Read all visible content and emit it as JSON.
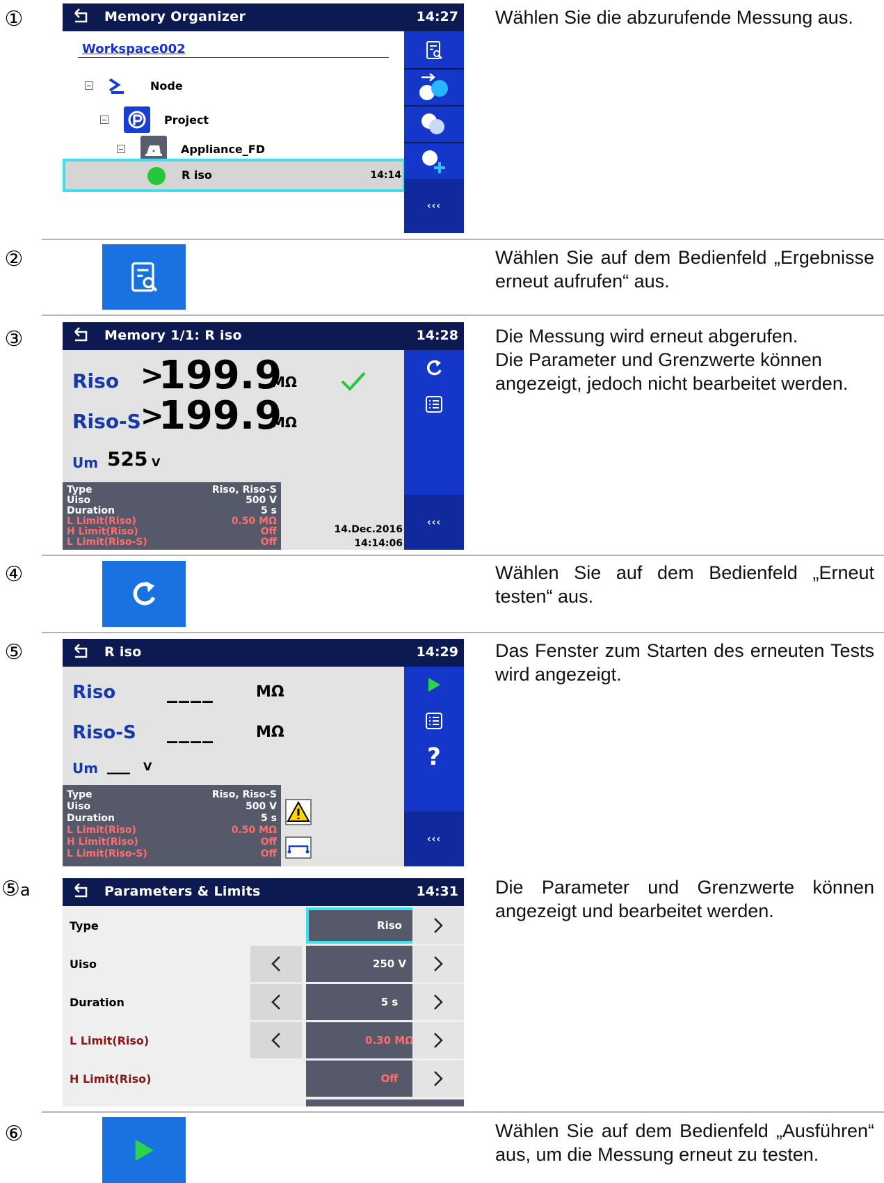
{
  "steps": [
    {
      "num": "①",
      "desc": [
        "Wählen Sie die abzurufende Messung aus."
      ]
    },
    {
      "num": "②",
      "desc": [
        "Wählen Sie auf dem Bedienfeld „Ergebnisse erneut aufrufen“ aus."
      ]
    },
    {
      "num": "③",
      "desc": [
        "Die Messung wird erneut abgerufen.",
        "Die Parameter und Grenzwerte können angezeigt, jedoch nicht bearbeitet werden."
      ]
    },
    {
      "num": "④",
      "desc": [
        "Wählen Sie auf dem Bedienfeld „Erneut testen“ aus."
      ]
    },
    {
      "num": "⑤",
      "desc": [
        "Das Fenster zum Starten des erneuten Tests wird angezeigt."
      ]
    },
    {
      "num": "⑤",
      "sub": "a",
      "desc": [
        "Die Parameter und Grenzwerte können angezeigt und bearbeitet werden."
      ]
    },
    {
      "num": "⑥",
      "desc": [
        "Wählen Sie auf dem Bedienfeld „Ausführen“ aus, um die Messung erneut zu testen."
      ]
    }
  ],
  "screen1": {
    "title": "Memory Organizer",
    "time": "14:27",
    "workspace": "Workspace002",
    "tree": [
      {
        "label": "Node"
      },
      {
        "label": "Project"
      },
      {
        "label": "Appliance_FD"
      }
    ],
    "result": {
      "label": "R iso",
      "time": "14:14",
      "status_color": "#22c83a"
    },
    "more": "‹‹‹"
  },
  "screen3": {
    "title": "Memory 1/1: R iso",
    "time": "14:28",
    "riso_label": "Riso",
    "riso_prefix": ">",
    "riso_value": "199.9",
    "riso_unit": "MΩ",
    "risos_label": "Riso-S",
    "risos_prefix": ">",
    "risos_value": "199.9",
    "risos_unit": "MΩ",
    "um_label": "Um",
    "um_value": "525",
    "um_unit": "V",
    "params": [
      {
        "k": "Type",
        "v": "Riso, Riso-S",
        "red": false
      },
      {
        "k": "Uiso",
        "v": "500 V",
        "red": false
      },
      {
        "k": "Duration",
        "v": "5 s",
        "red": false
      },
      {
        "k": "L Limit(Riso)",
        "v": "0.50 MΩ",
        "red": true
      },
      {
        "k": "H Limit(Riso)",
        "v": "Off",
        "red": true
      },
      {
        "k": "L Limit(Riso-S)",
        "v": "Off",
        "red": true
      }
    ],
    "date": "14.Dec.2016",
    "clock": "14:14:06",
    "more": "‹‹‹"
  },
  "screen5": {
    "title": "R iso",
    "time": "14:29",
    "riso_label": "Riso",
    "riso_value": "____",
    "riso_unit": "MΩ",
    "risos_label": "Riso-S",
    "risos_value": "____",
    "risos_unit": "MΩ",
    "um_label": "Um",
    "um_value": "___",
    "um_unit": "V",
    "help": "?",
    "params": [
      {
        "k": "Type",
        "v": "Riso, Riso-S",
        "red": false
      },
      {
        "k": "Uiso",
        "v": "500 V",
        "red": false
      },
      {
        "k": "Duration",
        "v": "5 s",
        "red": false
      },
      {
        "k": "L Limit(Riso)",
        "v": "0.50 MΩ",
        "red": true
      },
      {
        "k": "H Limit(Riso)",
        "v": "Off",
        "red": true
      },
      {
        "k": "L Limit(Riso-S)",
        "v": "Off",
        "red": true
      }
    ],
    "more": "‹‹‹"
  },
  "screen5a": {
    "title": "Parameters & Limits",
    "time": "14:31",
    "rows": [
      {
        "label": "Type",
        "value": "Riso",
        "red": false,
        "left": false
      },
      {
        "label": "Uiso",
        "value": "250 V",
        "red": false,
        "left": true
      },
      {
        "label": "Duration",
        "value": "5 s",
        "red": false,
        "left": true
      },
      {
        "label": "L Limit(Riso)",
        "value": "0.30 MΩ",
        "red": true,
        "left": true
      },
      {
        "label": "H Limit(Riso)",
        "value": "Off",
        "red": true,
        "left": false
      }
    ]
  },
  "colors": {
    "titlebar": "#0d1a52",
    "panel": "#1537c9",
    "accent_cyan": "#3ee0f0",
    "result_blue": "#173aa8",
    "param_gray": "#55596a",
    "limit_red": "#ff6e6e",
    "ok_green": "#22c83a",
    "button_blue": "#1a72e0"
  }
}
